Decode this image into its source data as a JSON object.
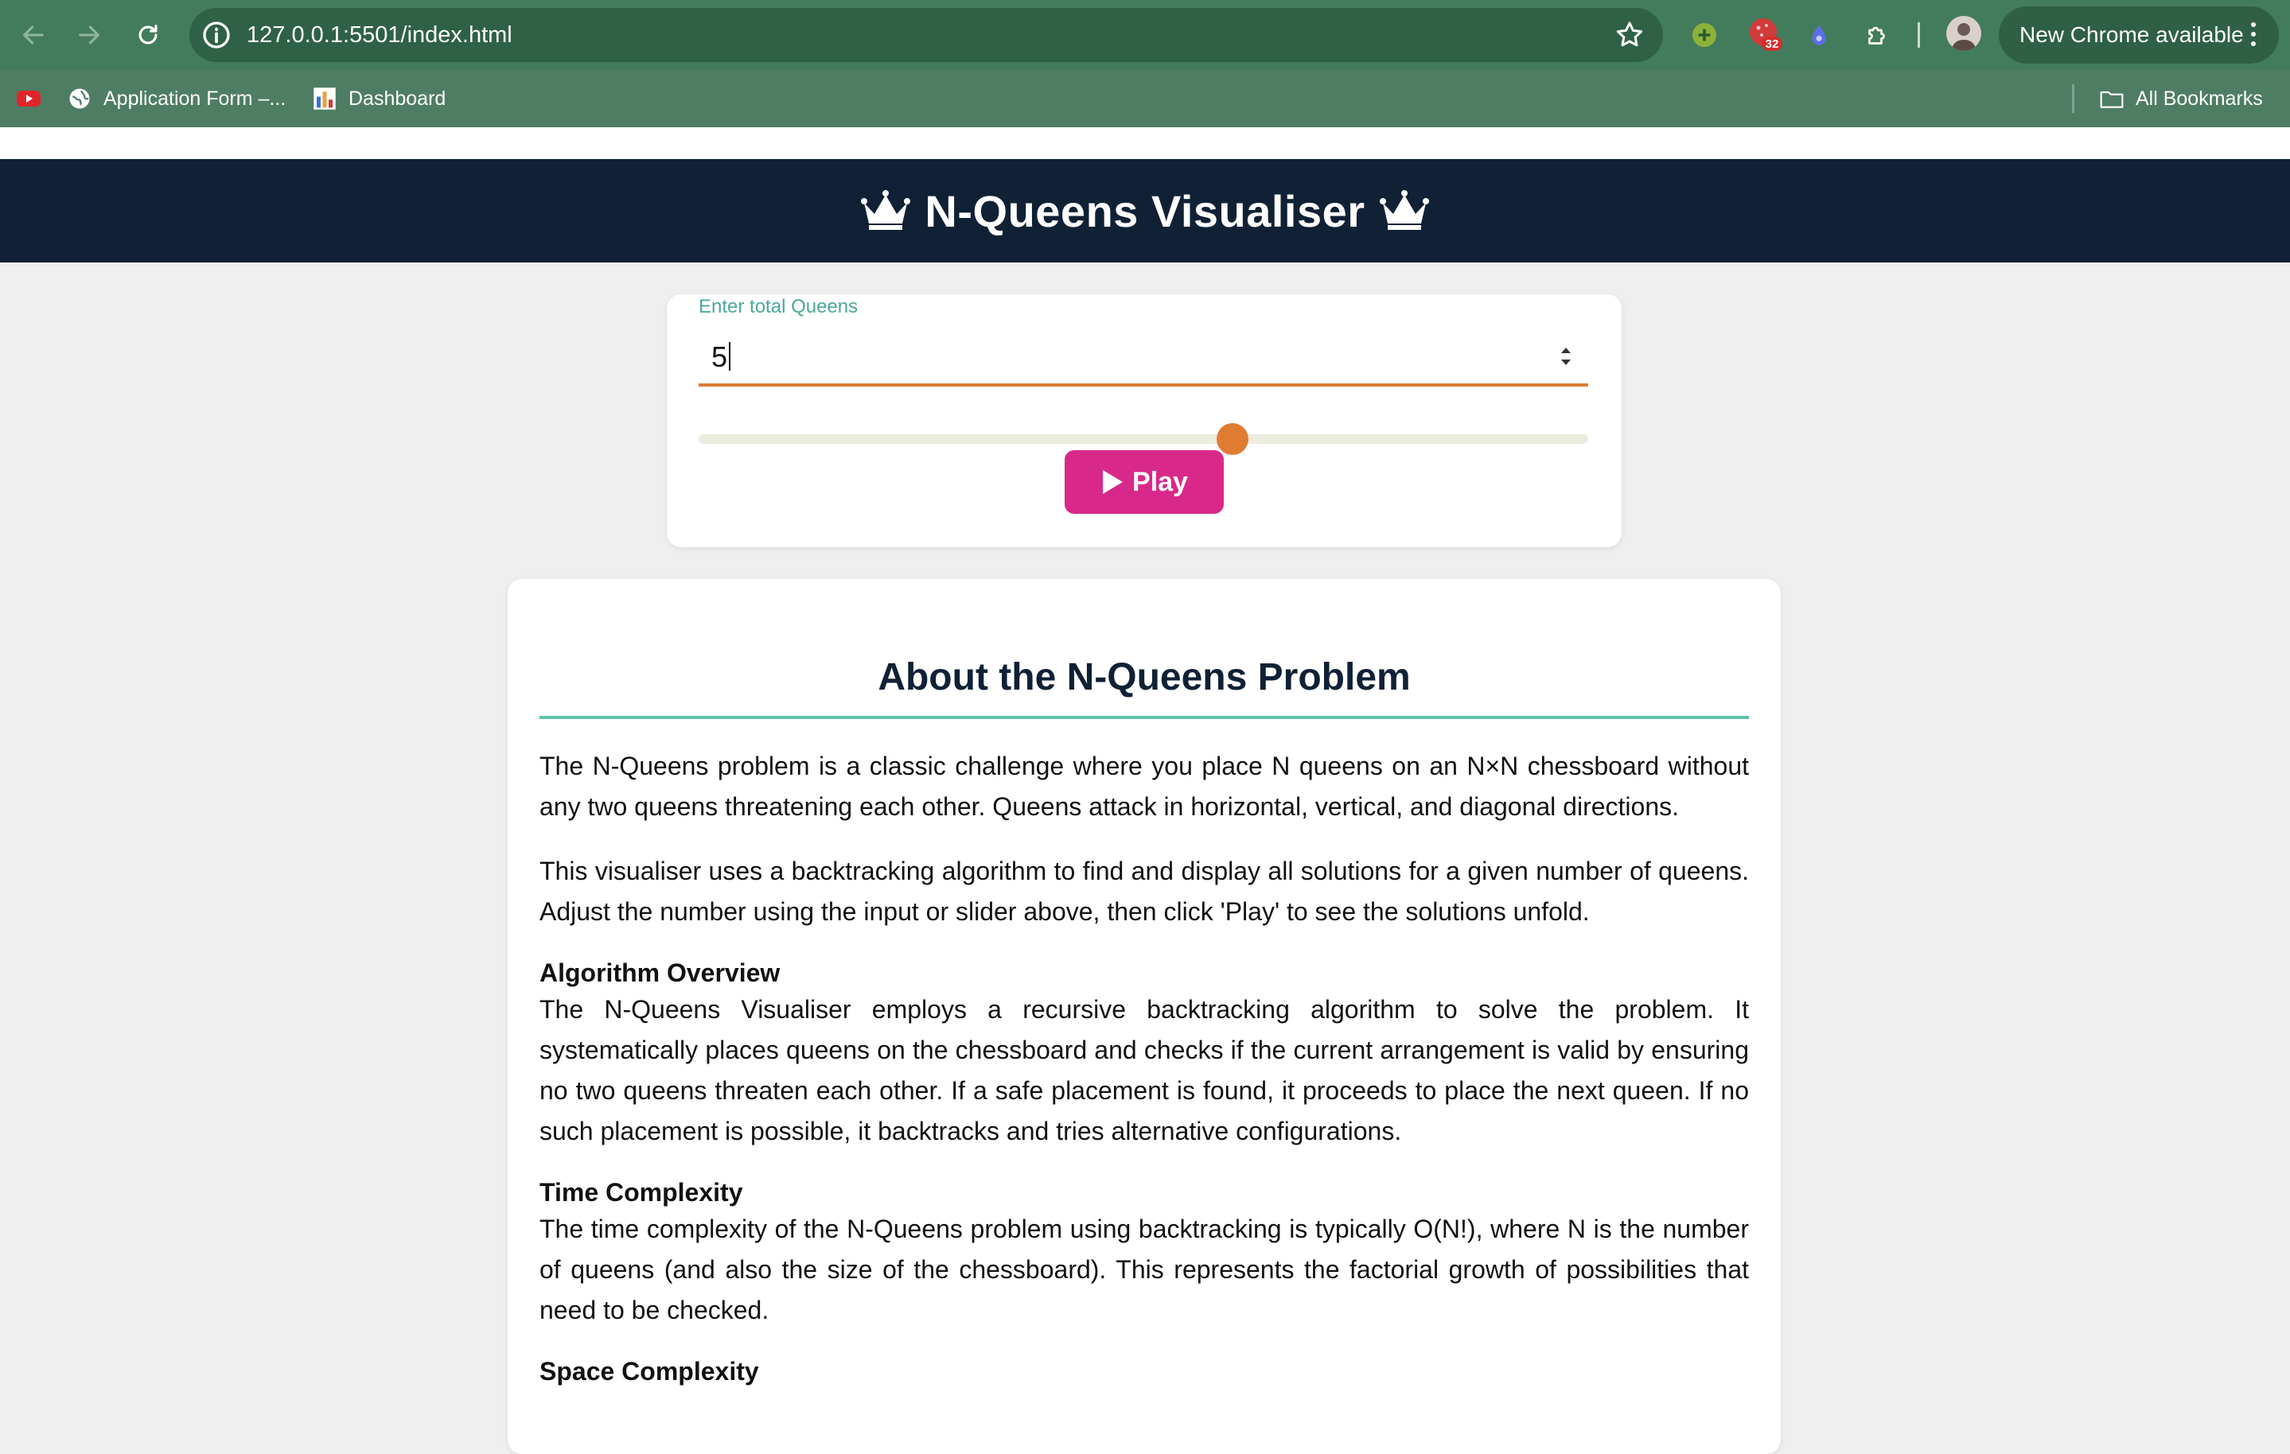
{
  "browser": {
    "url": "127.0.0.1:5501/index.html",
    "extension_badge": "32",
    "new_chrome_label": "New Chrome available",
    "bookmarks": [
      {
        "label": "Application Form –...",
        "icon": "globe-icon"
      },
      {
        "label": "Dashboard",
        "icon": "bar-chart-icon"
      }
    ],
    "all_bookmarks_label": "All Bookmarks"
  },
  "header": {
    "title": "N-Queens Visualiser",
    "icon": "crown-icon"
  },
  "controls": {
    "input_label": "Enter total Queens",
    "queens_value": "5",
    "slider_fraction": 0.6,
    "play_label": "Play",
    "accent_color": "#e07b32",
    "play_color": "#d8298a"
  },
  "about": {
    "title": "About the N-Queens Problem",
    "intro": "The N-Queens problem is a classic challenge where you place N queens on an N×N chessboard without any two queens threatening each other. Queens attack in horizontal, vertical, and diagonal directions.",
    "usage": "This visualiser uses a backtracking algorithm to find and display all solutions for a given number of queens. Adjust the number using the input or slider above, then click 'Play' to see the solutions unfold.",
    "sections": [
      {
        "heading": "Algorithm Overview",
        "text": "The N-Queens Visualiser employs a recursive backtracking algorithm to solve the problem. It systematically places queens on the chessboard and checks if the current arrangement is valid by ensuring no two queens threaten each other. If a safe placement is found, it proceeds to place the next queen. If no such placement is possible, it backtracks and tries alternative configurations."
      },
      {
        "heading": "Time Complexity",
        "text": "The time complexity of the N-Queens problem using backtracking is typically O(N!), where N is the number of queens (and also the size of the chessboard). This represents the factorial growth of possibilities that need to be checked."
      },
      {
        "heading": "Space Complexity",
        "text": ""
      }
    ]
  }
}
